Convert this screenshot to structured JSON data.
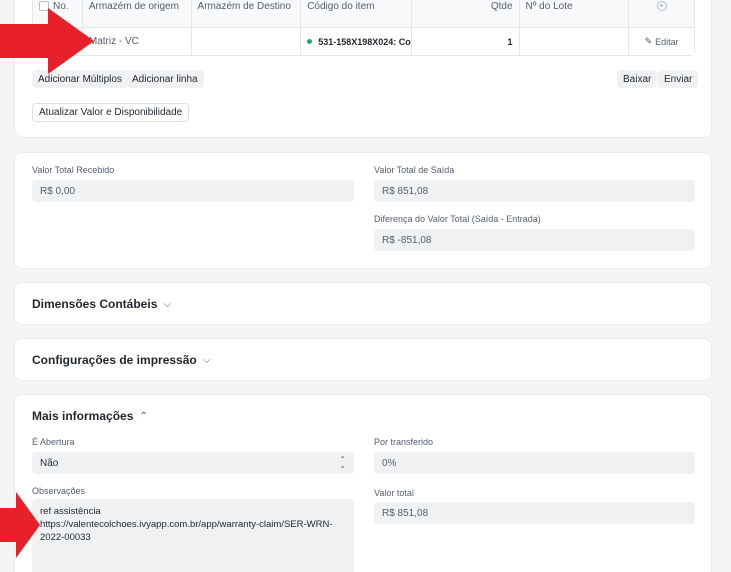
{
  "items_table": {
    "headers": [
      "No.",
      "Armazém de origem",
      "Armazém de Destino",
      "Código do item",
      "Qtde",
      "Nº do Lote"
    ],
    "row": {
      "origin": "Matriz - VC",
      "destination": "",
      "item_code": "531-158X198X024: Co",
      "qty": "1",
      "batch": "",
      "edit_label": "Editar"
    },
    "buttons": {
      "add_multiple": "Adicionar Múltiplos",
      "add_row": "Adicionar linha",
      "download": "Baixar",
      "upload": "Enviar",
      "update_value": "Atualizar Valor e Disponibilidade"
    }
  },
  "totals": {
    "received_label": "Valor Total Recebido",
    "received_value": "R$ 0,00",
    "outgoing_label": "Valor Total de Saída",
    "outgoing_value": "R$ 851,08",
    "difference_label": "Diferença do Valor Total (Saída - Entrada)",
    "difference_value": "R$ -851,08"
  },
  "sections": {
    "accounting": "Dimensões Contábeis",
    "print": "Configurações de impressão",
    "more": "Mais informações"
  },
  "more_info": {
    "opening_label": "É Abertura",
    "opening_value": "Não",
    "by_transfer_label": "Por transferido",
    "by_transfer_value": "0%",
    "notes_label": "Observações",
    "notes_lines": [
      "ref assistência",
      "https://valentecolchoes.ivyapp.com.br/app/warranty-claim/SER-WRN-",
      "2022-00033"
    ],
    "total_label": "Valor total",
    "total_value": "R$ 851,08"
  },
  "colors": {
    "arrow": "#e8202a",
    "status_dot": "#29a36a"
  }
}
